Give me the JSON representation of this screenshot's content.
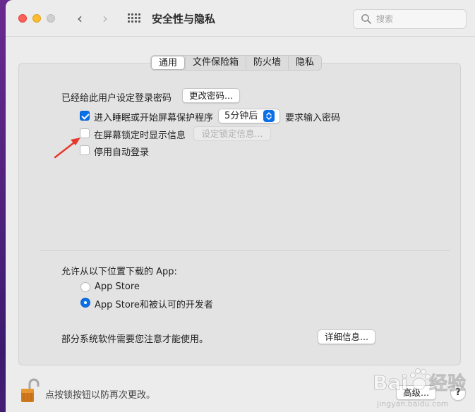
{
  "window": {
    "title": "安全性与隐私",
    "nav_back": "‹",
    "nav_forward": "›"
  },
  "search": {
    "placeholder": "搜索"
  },
  "tabs": [
    {
      "label": "通用",
      "active": true
    },
    {
      "label": "文件保险箱",
      "active": false
    },
    {
      "label": "防火墙",
      "active": false
    },
    {
      "label": "隐私",
      "active": false
    }
  ],
  "general": {
    "password_label": "已经给此用户设定登录密码",
    "change_password_button": "更改密码...",
    "require_password": {
      "checked": true,
      "label_before": "进入睡眠或开始屏幕保护程序",
      "delay_value": "5分钟后",
      "label_after": "要求输入密码"
    },
    "show_message": {
      "checked": false,
      "label": "在屏幕锁定时显示信息",
      "button": "设定锁定信息..."
    },
    "disable_autologin": {
      "checked": false,
      "label": "停用自动登录"
    }
  },
  "downloads": {
    "heading": "允许从以下位置下载的 App:",
    "options": [
      {
        "label": "App Store",
        "selected": false
      },
      {
        "label": "App Store和被认可的开发者",
        "selected": true
      }
    ]
  },
  "notice": {
    "text": "部分系统软件需要您注意才能使用。",
    "details_button": "详细信息..."
  },
  "footer": {
    "lock_text": "点按锁按钮以防再次更改。",
    "advanced_button": "高级...",
    "help_button": "?"
  },
  "watermark": {
    "text": "Bai度经验",
    "subtext": "jingyan.baidu.com"
  },
  "colors": {
    "accent": "#0a70e8",
    "arrow": "#e8362a"
  }
}
